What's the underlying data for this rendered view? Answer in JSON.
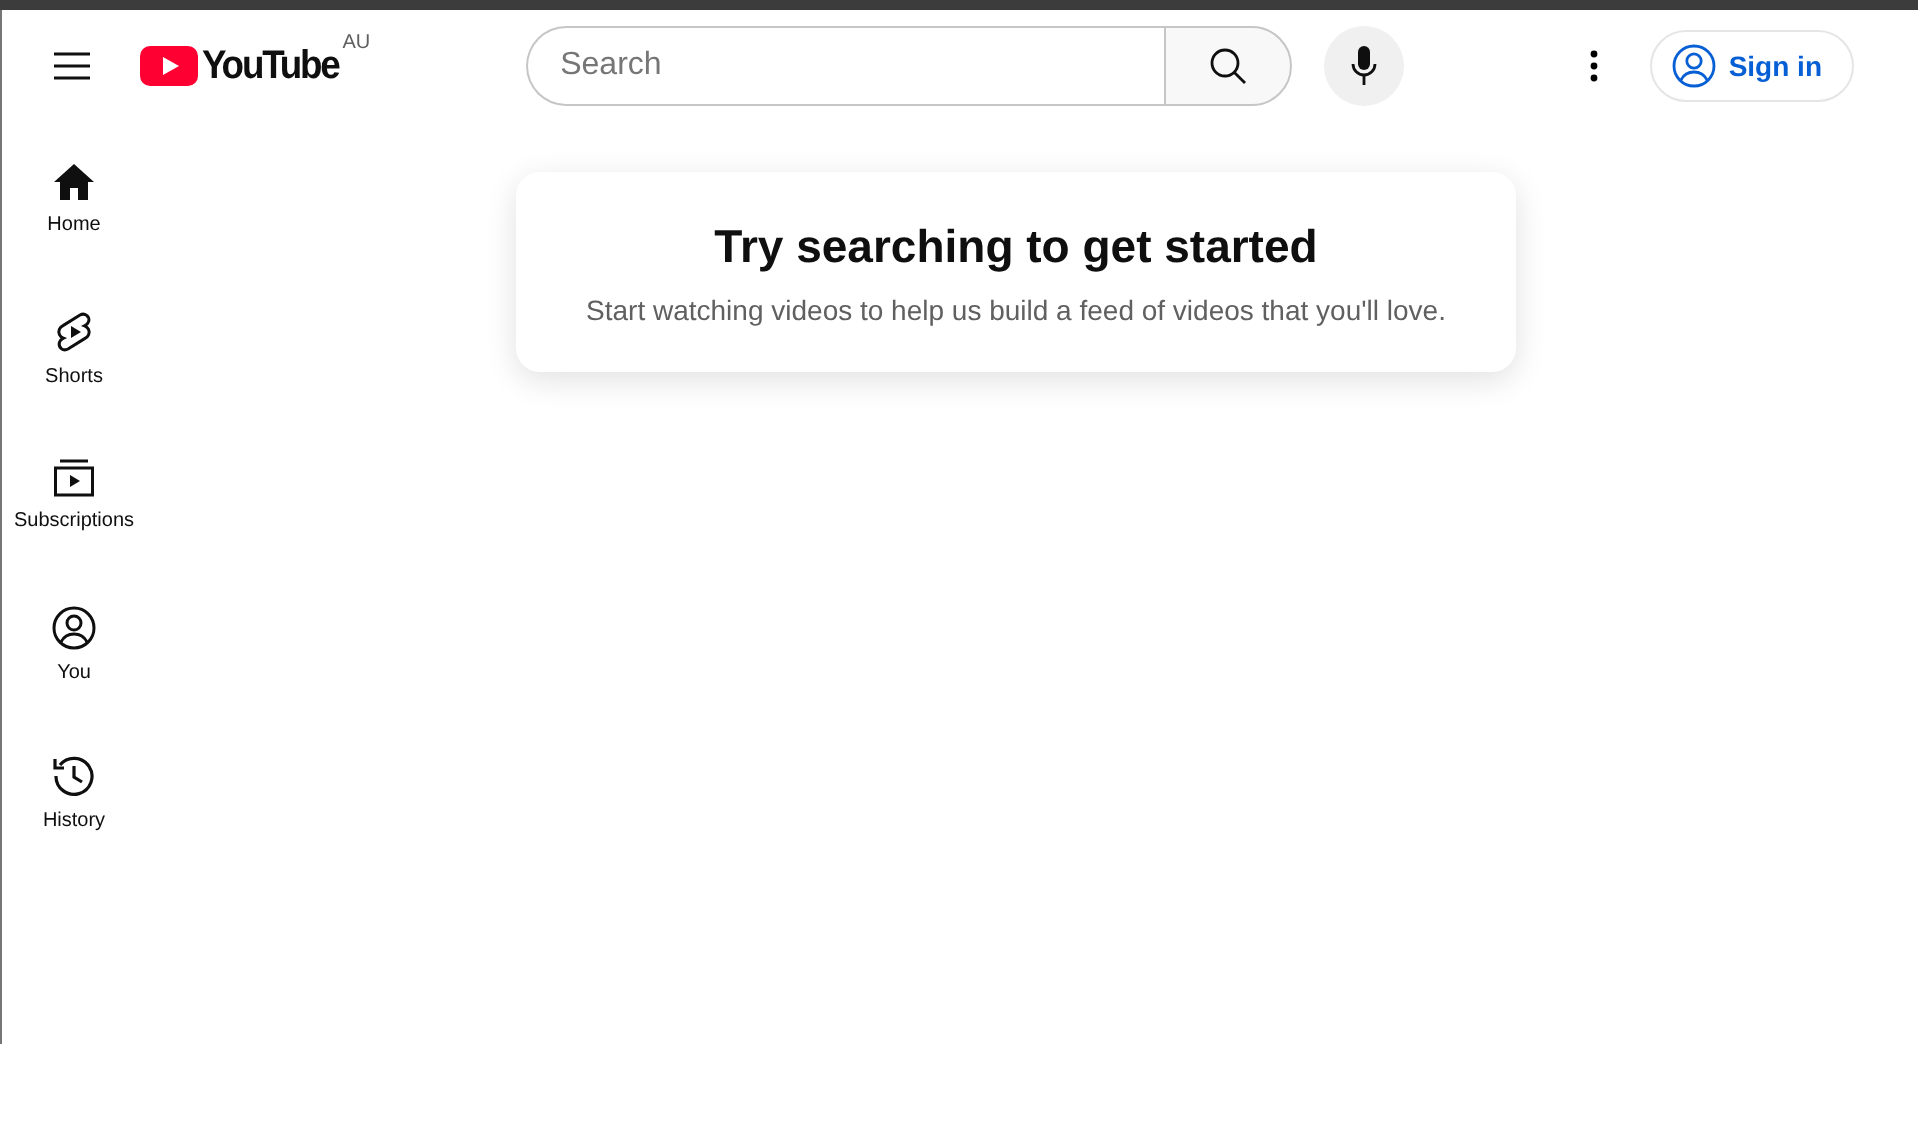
{
  "header": {
    "logo": "YouTube",
    "region": "AU",
    "search": {
      "placeholder": "Search"
    },
    "sign_in": "Sign in"
  },
  "sidebar": {
    "items": [
      {
        "label": "Home",
        "kind": "home",
        "selected": true
      },
      {
        "label": "Shorts",
        "kind": "shorts",
        "selected": false
      },
      {
        "label": "Subscriptions",
        "kind": "subscriptions",
        "selected": false
      },
      {
        "label": "You",
        "kind": "you",
        "selected": false
      },
      {
        "label": "History",
        "kind": "history",
        "selected": false
      }
    ]
  },
  "prompt": {
    "title": "Try searching to get started",
    "text": "Start watching videos to help us build a feed of videos that you'll love."
  }
}
